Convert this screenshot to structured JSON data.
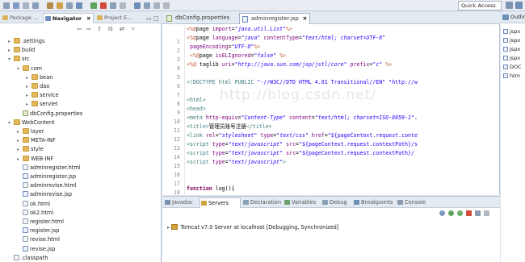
{
  "toolbar": {
    "quick_access": "Quick Access"
  },
  "left_panel": {
    "tabs": [
      {
        "label": "Package ...",
        "active": false
      },
      {
        "label": "Navigator",
        "active": true
      },
      {
        "label": "Project E...",
        "active": false
      }
    ],
    "tree": [
      {
        "label": ".settings",
        "type": "folder",
        "level": 1,
        "twisty": "closed"
      },
      {
        "label": "build",
        "type": "folder",
        "level": 1,
        "twisty": "closed"
      },
      {
        "label": "src",
        "type": "folder",
        "level": 1,
        "twisty": "open"
      },
      {
        "label": "com",
        "type": "folder",
        "level": 2,
        "twisty": "open"
      },
      {
        "label": "bean",
        "type": "folder",
        "level": 3,
        "twisty": "closed"
      },
      {
        "label": "dao",
        "type": "folder",
        "level": 3,
        "twisty": "closed"
      },
      {
        "label": "service",
        "type": "folder",
        "level": 3,
        "twisty": "closed"
      },
      {
        "label": "servlet",
        "type": "folder",
        "level": 3,
        "twisty": "closed"
      },
      {
        "label": "dbConfig.properties",
        "type": "prop",
        "level": 2,
        "twisty": ""
      },
      {
        "label": "WebContent",
        "type": "folder",
        "level": 1,
        "twisty": "open"
      },
      {
        "label": "layer",
        "type": "folder",
        "level": 2,
        "twisty": "closed"
      },
      {
        "label": "META-INF",
        "type": "folder",
        "level": 2,
        "twisty": "closed"
      },
      {
        "label": "style",
        "type": "folder",
        "level": 2,
        "twisty": "closed"
      },
      {
        "label": "WEB-INF",
        "type": "folder",
        "level": 2,
        "twisty": "closed"
      },
      {
        "label": "adminregister.html",
        "type": "file",
        "level": 2,
        "twisty": ""
      },
      {
        "label": "adminregister.jsp",
        "type": "jsp",
        "level": 2,
        "twisty": ""
      },
      {
        "label": "adminrevise.html",
        "type": "file",
        "level": 2,
        "twisty": ""
      },
      {
        "label": "adminrevise.jsp",
        "type": "jsp",
        "level": 2,
        "twisty": ""
      },
      {
        "label": "ok.html",
        "type": "file",
        "level": 2,
        "twisty": ""
      },
      {
        "label": "ok2.html",
        "type": "file",
        "level": 2,
        "twisty": ""
      },
      {
        "label": "register.html",
        "type": "file",
        "level": 2,
        "twisty": ""
      },
      {
        "label": "register.jsp",
        "type": "jsp",
        "level": 2,
        "twisty": ""
      },
      {
        "label": "revise.html",
        "type": "file",
        "level": 2,
        "twisty": ""
      },
      {
        "label": "revise.jsp",
        "type": "jsp",
        "level": 2,
        "twisty": ""
      },
      {
        "label": ".classpath",
        "type": "file",
        "level": 1,
        "twisty": ""
      }
    ]
  },
  "editor": {
    "tabs": [
      {
        "label": "dbConfig.properties",
        "active": false
      },
      {
        "label": "adminregister.jsp",
        "active": true,
        "close": "✖"
      }
    ],
    "line_numbers": [
      "1",
      "2",
      "3",
      "4",
      "5",
      "6",
      "7",
      "8",
      "9",
      "10",
      "11",
      "12",
      "13",
      "14",
      "15",
      "16",
      "17",
      "18",
      "19"
    ],
    "lines": [
      [
        [
          "dr",
          "<%@"
        ],
        [
          "",
          "page "
        ],
        [
          "at",
          "import"
        ],
        [
          "",
          "="
        ],
        [
          "sv",
          "\"java.util.List\""
        ],
        [
          "dr",
          "%>"
        ]
      ],
      [
        [
          "dr",
          "<%@"
        ],
        [
          "",
          ""
        ],
        [
          "",
          "page "
        ],
        [
          "at",
          "language"
        ],
        [
          "",
          "="
        ],
        [
          "sv",
          "\"java\""
        ],
        [
          "",
          " "
        ],
        [
          "at",
          "contentType"
        ],
        [
          "",
          "="
        ],
        [
          "sv",
          "\"text/html; charset=UTF-8\""
        ]
      ],
      [
        [
          "",
          " "
        ],
        [
          "at",
          "pageEncoding"
        ],
        [
          "",
          "="
        ],
        [
          "sv",
          "\"UTF-8\""
        ],
        [
          "dr",
          "%>"
        ]
      ],
      [
        [
          "",
          " "
        ],
        [
          "dr",
          "<%@"
        ],
        [
          "",
          "page "
        ],
        [
          "at",
          "isELIgnored"
        ],
        [
          "",
          "="
        ],
        [
          "sv",
          "\"false\""
        ],
        [
          "",
          " "
        ],
        [
          "dr",
          "%>"
        ]
      ],
      [
        [
          "dr",
          "<%@"
        ],
        [
          "",
          " taglib "
        ],
        [
          "at",
          "uri"
        ],
        [
          "",
          "="
        ],
        [
          "sv",
          "\"http://java.sun.com/jsp/jstl/core\""
        ],
        [
          "",
          " "
        ],
        [
          "at",
          "prefix"
        ],
        [
          "",
          "="
        ],
        [
          "sv",
          "\"c\""
        ],
        [
          "",
          " "
        ],
        [
          "dr",
          "%>"
        ]
      ],
      [],
      [
        [
          "tg",
          "<!DOCTYPE html PUBLIC "
        ],
        [
          "js",
          "\"-//W3C//DTD HTML 4.01 Transitional//EN\""
        ],
        [
          "",
          " "
        ],
        [
          "js",
          "\"http://w"
        ]
      ],
      [],
      [
        [
          "tg",
          "<html>"
        ]
      ],
      [
        [
          "tg",
          "<head>"
        ]
      ],
      [
        [
          "tg",
          "<meta "
        ],
        [
          "at",
          "http-equiv"
        ],
        [
          "",
          "="
        ],
        [
          "sv",
          "\"Content-Type\""
        ],
        [
          "",
          " "
        ],
        [
          "at",
          "content"
        ],
        [
          "",
          "="
        ],
        [
          "sv",
          "\"text/html; charset=ISO-8859-1\""
        ],
        [
          "",
          "."
        ]
      ],
      [
        [
          "tg",
          "<title>"
        ],
        [
          "",
          "管理员账号注册"
        ],
        [
          "tg",
          "</title>"
        ]
      ],
      [
        [
          "tg",
          "<link "
        ],
        [
          "at",
          "rel"
        ],
        [
          "",
          "="
        ],
        [
          "sv",
          "\"stylesheet\""
        ],
        [
          "",
          " "
        ],
        [
          "at",
          "type"
        ],
        [
          "",
          "="
        ],
        [
          "sv",
          "\"text/css\""
        ],
        [
          "",
          " "
        ],
        [
          "at",
          "href"
        ],
        [
          "",
          "="
        ],
        [
          "js",
          "\"${pageContext.request.conte"
        ]
      ],
      [
        [
          "tg",
          "<script "
        ],
        [
          "at",
          "type"
        ],
        [
          "",
          "="
        ],
        [
          "sv",
          "\"text/javascript\""
        ],
        [
          "",
          " "
        ],
        [
          "at",
          "src"
        ],
        [
          "",
          "="
        ],
        [
          "js",
          "\"${pageContext.request.contextPath}/s"
        ]
      ],
      [
        [
          "tg",
          "<script "
        ],
        [
          "at",
          "type"
        ],
        [
          "",
          "="
        ],
        [
          "sv",
          "\"text/javascript\""
        ],
        [
          "",
          " "
        ],
        [
          "at",
          "src"
        ],
        [
          "",
          "="
        ],
        [
          "js",
          "\"${pageContext.request.contextPath}/"
        ]
      ],
      [
        [
          "tg",
          "<script "
        ],
        [
          "at",
          "type"
        ],
        [
          "",
          "="
        ],
        [
          "sv",
          "\"text/javascript\""
        ],
        [
          "tg",
          ">"
        ]
      ],
      [],
      [],
      [
        [
          "k",
          "function"
        ],
        [
          "",
          " log(){"
        ]
      ]
    ]
  },
  "outline": {
    "tab_label": "Outline",
    "items": [
      "jspx",
      "jspx",
      "jspx",
      "jspx",
      "DOC",
      "htm"
    ]
  },
  "bottom_panel": {
    "tabs": [
      {
        "label": "Javadoc",
        "active": false,
        "color": "#7a8fb0"
      },
      {
        "label": "Servers",
        "active": true,
        "color": "#d3a23c"
      },
      {
        "label": "Declaration",
        "active": false,
        "color": "#8aa0b8"
      },
      {
        "label": "Variables",
        "active": false,
        "color": "#6aa16a"
      },
      {
        "label": "Debug",
        "active": false,
        "color": "#8aa0b8"
      },
      {
        "label": "Breakpoints",
        "active": false,
        "color": "#6d8fb8"
      },
      {
        "label": "Console",
        "active": false,
        "color": "#8a9aaf"
      }
    ],
    "server_entry": "Tomcat v7.0 Server at localhost  [Debugging, Synchronized]"
  },
  "watermark": "http://blog.csdn.net/"
}
